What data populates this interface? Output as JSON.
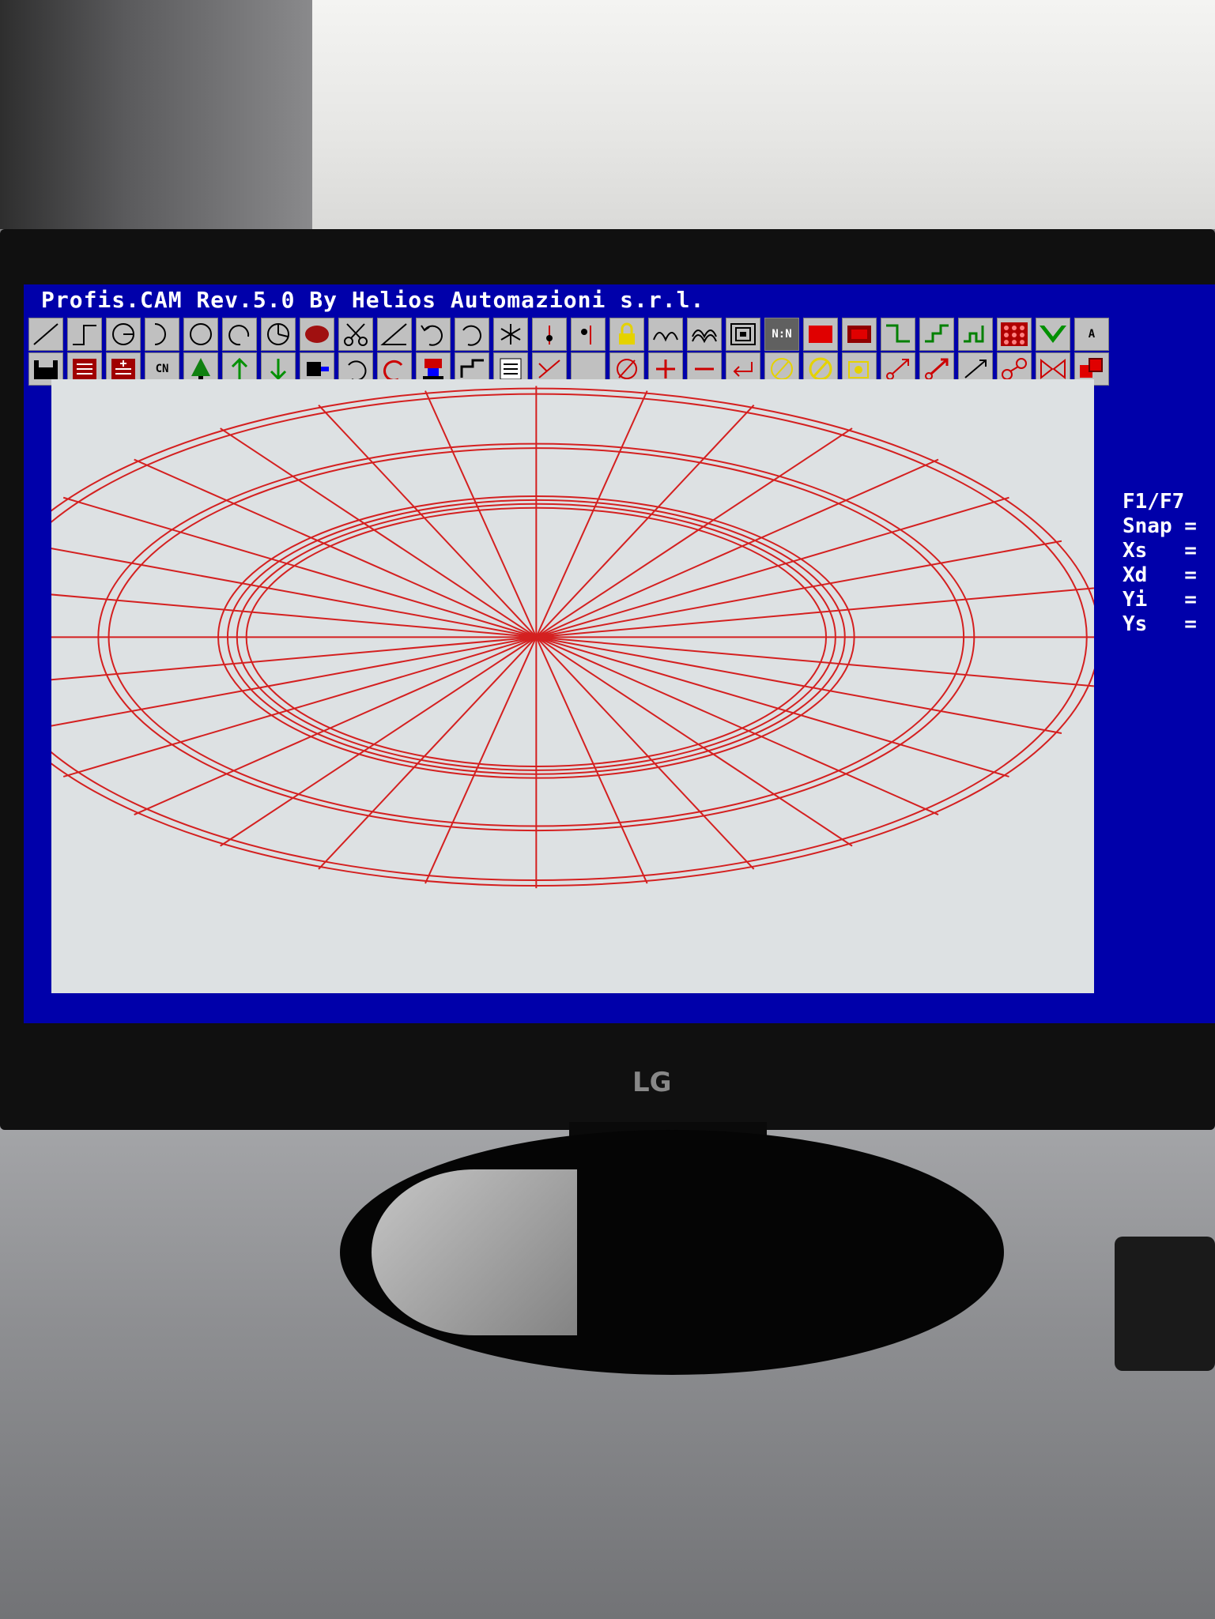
{
  "window": {
    "title": "Profis.CAM Rev.5.0 By Helios Automazioni s.r.l."
  },
  "toolbar_row1": [
    {
      "icon": "line-icon"
    },
    {
      "icon": "step-line-icon"
    },
    {
      "icon": "circle-center-icon"
    },
    {
      "icon": "arc-icon"
    },
    {
      "icon": "circle-icon"
    },
    {
      "icon": "arc-open-icon"
    },
    {
      "icon": "pie-icon"
    },
    {
      "icon": "filled-ellipse-icon"
    },
    {
      "icon": "scissors-icon"
    },
    {
      "icon": "angle-icon"
    },
    {
      "icon": "undo-arc-icon"
    },
    {
      "icon": "undo-arc-2-icon"
    },
    {
      "icon": "asterisk-icon"
    },
    {
      "icon": "arrow-point-icon"
    },
    {
      "icon": "arrow-point-2-icon"
    },
    {
      "icon": "lock-icon"
    },
    {
      "icon": "wave-icon"
    },
    {
      "icon": "multi-wave-icon"
    },
    {
      "icon": "concentric-square-icon"
    },
    {
      "icon": "nn-icon",
      "label": "N:N"
    },
    {
      "icon": "red-rect-icon"
    },
    {
      "icon": "red-frame-icon"
    },
    {
      "icon": "step-down-icon"
    },
    {
      "icon": "step-up-icon"
    },
    {
      "icon": "step-multi-icon"
    },
    {
      "icon": "grid-dots-icon"
    },
    {
      "icon": "green-chevron-icon"
    },
    {
      "icon": "text-icon",
      "label": "A"
    }
  ],
  "toolbar_row2": [
    {
      "icon": "save-icon"
    },
    {
      "icon": "list-icon"
    },
    {
      "icon": "list-plus-icon"
    },
    {
      "icon": "cn-icon",
      "label": "CN"
    },
    {
      "icon": "tree-icon"
    },
    {
      "icon": "arrow-up-icon"
    },
    {
      "icon": "arrow-down-icon"
    },
    {
      "icon": "tool-icon"
    },
    {
      "icon": "rotate-left-icon"
    },
    {
      "icon": "rotate-right-icon"
    },
    {
      "icon": "machine-icon"
    },
    {
      "icon": "step-corner-icon"
    },
    {
      "icon": "list-2-icon"
    },
    {
      "icon": "cross-arrow-icon"
    },
    {
      "icon": "blank-icon"
    },
    {
      "icon": "diameter-icon"
    },
    {
      "icon": "plus-icon"
    },
    {
      "icon": "minus-icon"
    },
    {
      "icon": "return-arrow-icon"
    },
    {
      "icon": "slash-circle-icon"
    },
    {
      "icon": "slash-circle-2-icon"
    },
    {
      "icon": "gear-question-icon"
    },
    {
      "icon": "diagonal-arrow-icon"
    },
    {
      "icon": "diagonal-arrow-2-icon"
    },
    {
      "icon": "diagonal-arrow-3-icon"
    },
    {
      "icon": "link-icon"
    },
    {
      "icon": "mirror-icon"
    },
    {
      "icon": "red-cubes-icon"
    }
  ],
  "side_panel": {
    "lines": [
      "F1/F7",
      "Snap =",
      "Xs   =",
      "Xd   =",
      "Yi   =",
      "Ys   ="
    ]
  },
  "drawing": {
    "stroke_color": "#d42020",
    "background": "#dde1e3",
    "radial_lines": 32,
    "ellipse_rings": [
      {
        "rx": 0.54,
        "ry": 0.45
      },
      {
        "rx": 0.528,
        "ry": 0.44
      },
      {
        "rx": 0.42,
        "ry": 0.35
      },
      {
        "rx": 0.41,
        "ry": 0.342
      },
      {
        "rx": 0.305,
        "ry": 0.255
      },
      {
        "rx": 0.296,
        "ry": 0.248
      },
      {
        "rx": 0.287,
        "ry": 0.241
      },
      {
        "rx": 0.278,
        "ry": 0.234
      }
    ]
  },
  "monitor_brand": "LG"
}
